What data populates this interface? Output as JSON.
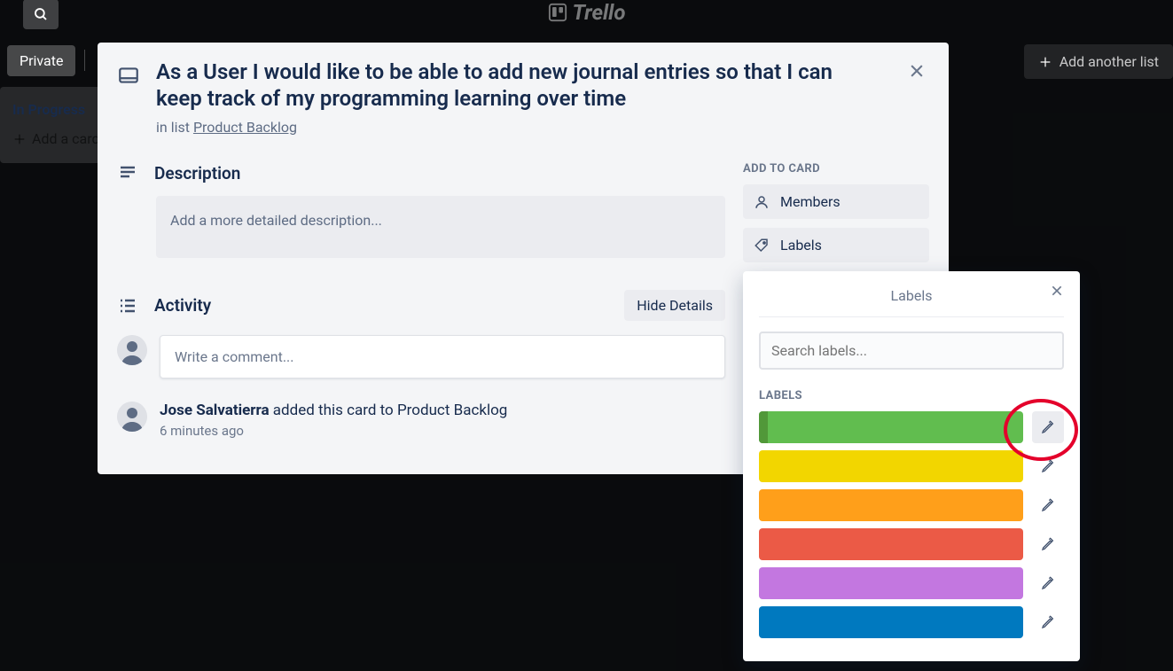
{
  "app": {
    "name": "Trello"
  },
  "board": {
    "private_label": "Private",
    "add_list_label": "Add another list",
    "list": {
      "title": "In Progress",
      "add_card_label": "Add a card"
    }
  },
  "card": {
    "title": "As a User I would like to be able to add new journal entries so that I can keep track of my programming learning over time",
    "inlist_prefix": "in list ",
    "list_link": "Product Backlog",
    "description_heading": "Description",
    "description_placeholder": "Add a more detailed description...",
    "activity_heading": "Activity",
    "hide_details_label": "Hide Details",
    "comment_placeholder": "Write a comment...",
    "activity_item": {
      "author": "Jose Salvatierra",
      "action": " added this card to Product Backlog",
      "time": "6 minutes ago"
    }
  },
  "sidebar": {
    "add_to_card_heading": "ADD TO CARD",
    "members_label": "Members",
    "labels_label": "Labels"
  },
  "labels_popover": {
    "title": "Labels",
    "search_placeholder": "Search labels...",
    "heading": "LABELS",
    "colors": [
      {
        "name": "green",
        "hex": "#61bd4f"
      },
      {
        "name": "yellow",
        "hex": "#f2d600"
      },
      {
        "name": "orange",
        "hex": "#ff9f1a"
      },
      {
        "name": "red",
        "hex": "#eb5a46"
      },
      {
        "name": "purple",
        "hex": "#c377e0"
      },
      {
        "name": "blue",
        "hex": "#0079bf"
      }
    ]
  },
  "annotation": {
    "type": "red-circle",
    "target": "first label edit pencil"
  }
}
